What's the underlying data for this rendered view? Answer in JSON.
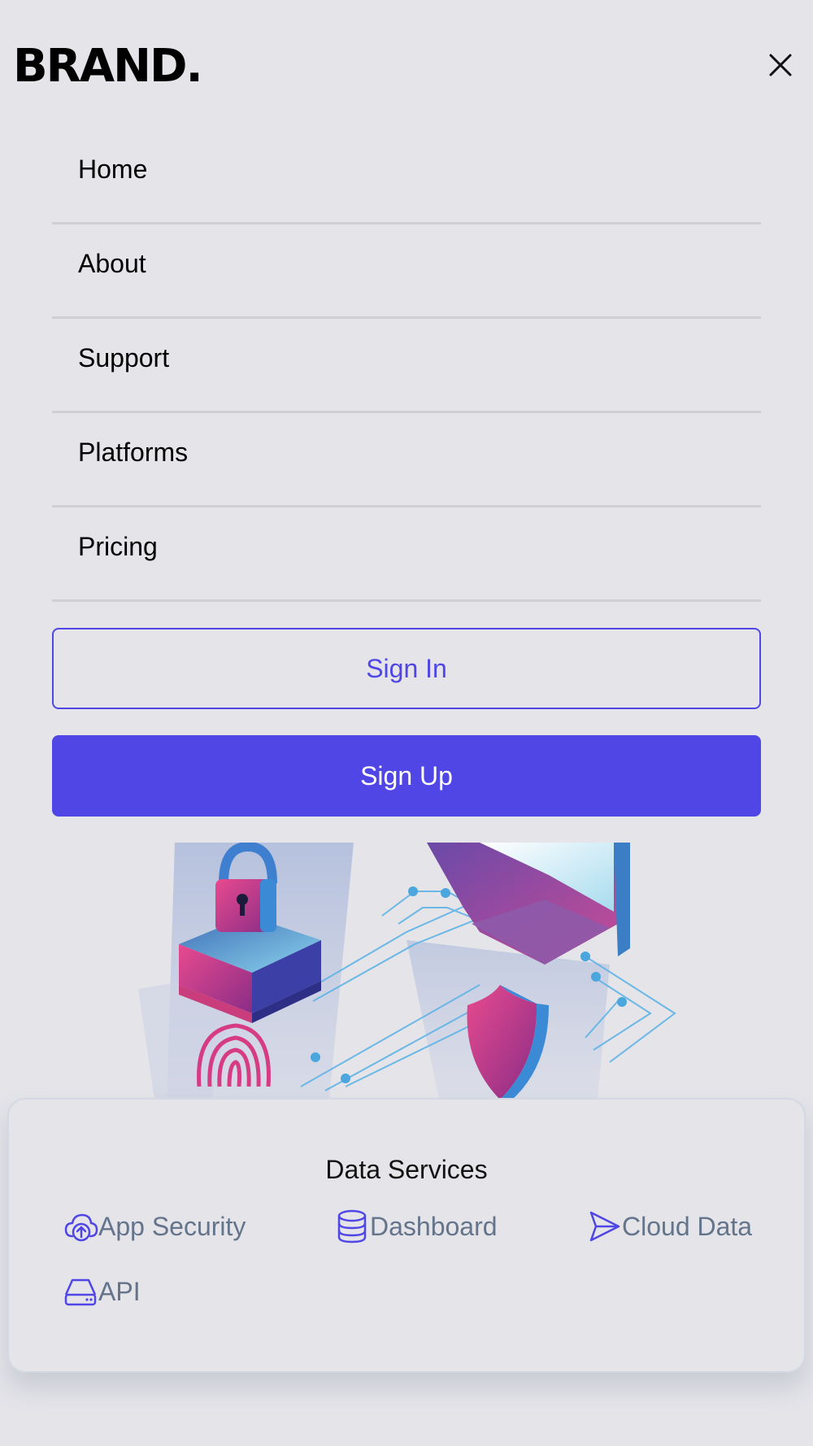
{
  "header": {
    "brand": "BRAND."
  },
  "nav": {
    "items": [
      {
        "label": "Home"
      },
      {
        "label": "About"
      },
      {
        "label": "Support"
      },
      {
        "label": "Platforms"
      },
      {
        "label": "Pricing"
      }
    ]
  },
  "auth": {
    "sign_in_label": "Sign In",
    "sign_up_label": "Sign Up"
  },
  "services": {
    "title": "Data Services",
    "items": [
      {
        "label": "App Security",
        "icon": "cloud-upload-icon"
      },
      {
        "label": "Dashboard",
        "icon": "database-icon"
      },
      {
        "label": "Cloud Data",
        "icon": "send-icon"
      },
      {
        "label": "API",
        "icon": "hard-drive-icon"
      }
    ]
  },
  "colors": {
    "accent": "#4f46e5",
    "background": "#e4e4e9",
    "muted_text": "#64748b"
  }
}
